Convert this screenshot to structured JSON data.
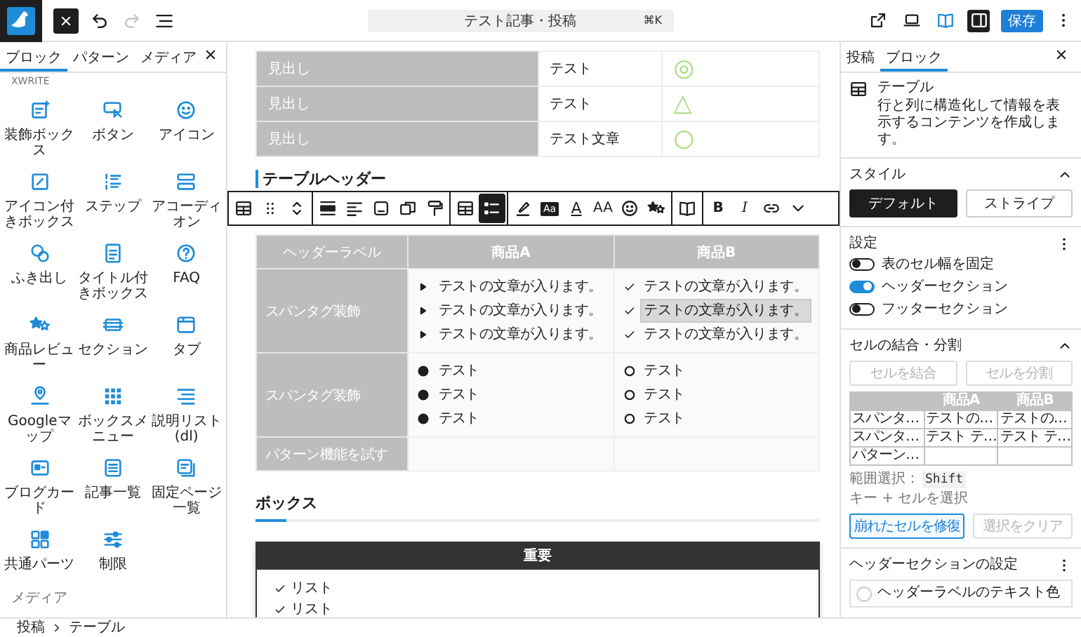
{
  "top_bar": {
    "history": [
      {
        "disabled": false
      },
      {
        "disabled": true
      }
    ],
    "command": {
      "title": "テスト記事・投稿",
      "shortcut": "⌘K"
    },
    "view_buttons": [
      {
        "selected": false
      },
      {
        "selected": false
      },
      {
        "selected": false
      },
      {
        "selected": true
      }
    ],
    "save": "保存"
  },
  "inserter": {
    "tabs": [
      {
        "label": "ブロック",
        "selected": true
      },
      {
        "label": "パターン",
        "selected": false
      },
      {
        "label": "メディア",
        "selected": false
      }
    ],
    "category": "XWRITE",
    "blocks": [
      "装飾ボックス",
      "ボタン",
      "アイコン",
      "アイコン付きボックス",
      "ステップ",
      "アコーディオン",
      "ふき出し",
      "タイトル付きボックス",
      "FAQ",
      "商品レビュー",
      "セクション",
      "タブ",
      "Googleマップ",
      "ボックスメニュー",
      "説明リスト(dl)",
      "ブログカード",
      "記事一覧",
      "固定ページ一覧",
      "共通パーツ",
      "制限"
    ],
    "next_category": "メディア"
  },
  "editor": {
    "top_table": {
      "rows": [
        {
          "header": "見出し",
          "text": "テスト",
          "mark": "◎"
        },
        {
          "header": "見出し",
          "text": "テスト",
          "mark": "△"
        },
        {
          "header": "見出し",
          "text": "テスト文章",
          "mark": "○"
        }
      ]
    },
    "heading": "テーブルヘッダー",
    "toolbar": {
      "groups": [
        {
          "items": [
            {
              "kind": "icon",
              "selected": false
            },
            {
              "kind": "icon",
              "selected": false
            },
            {
              "kind": "icon",
              "selected": false
            }
          ]
        },
        {
          "items": [
            {
              "kind": "icon",
              "selected": false
            },
            {
              "kind": "icon",
              "selected": false
            },
            {
              "kind": "icon",
              "selected": false
            },
            {
              "kind": "icon",
              "selected": false
            },
            {
              "kind": "icon",
              "selected": false
            }
          ]
        },
        {
          "items": [
            {
              "kind": "icon",
              "selected": false
            },
            {
              "kind": "icon",
              "selected": true
            }
          ]
        },
        {
          "items": [
            {
              "kind": "icon",
              "selected": false
            },
            {
              "kind": "badge",
              "label": "Aa",
              "selected": false
            },
            {
              "kind": "underline",
              "label": "A",
              "selected": false
            },
            {
              "kind": "text",
              "label": "AA",
              "selected": false
            },
            {
              "kind": "icon",
              "selected": false
            },
            {
              "kind": "icon",
              "selected": false
            }
          ]
        },
        {
          "items": [
            {
              "kind": "icon",
              "selected": false
            }
          ]
        },
        {
          "items": [
            {
              "kind": "bold",
              "label": "B",
              "selected": false
            },
            {
              "kind": "italic",
              "label": "I",
              "selected": false
            },
            {
              "kind": "icon",
              "selected": false
            },
            {
              "kind": "icon",
              "selected": false
            }
          ]
        }
      ]
    },
    "table": {
      "columns": [
        "ヘッダーラベル",
        "商品A",
        "商品B"
      ],
      "rows": [
        {
          "cells": [
            {
              "kind": "header",
              "text": "スパンタグ装飾"
            },
            {
              "kind": "triangle",
              "items": [
                {
                  "text": "テストの文章が入ります。",
                  "highlighted": false
                },
                {
                  "text": "テストの文章が入ります。",
                  "highlighted": false
                },
                {
                  "text": "テストの文章が入ります。",
                  "highlighted": false
                }
              ]
            },
            {
              "kind": "check",
              "items": [
                {
                  "text": "テストの文章が入ります。",
                  "highlighted": false
                },
                {
                  "text": "テストの文章が入ります。",
                  "highlighted": true
                },
                {
                  "text": "テストの文章が入ります。",
                  "highlighted": false
                }
              ]
            }
          ]
        },
        {
          "cells": [
            {
              "kind": "header",
              "text": "スパンタグ装飾"
            },
            {
              "kind": "dot",
              "items": [
                {
                  "text": "テスト",
                  "highlighted": false
                },
                {
                  "text": "テスト",
                  "highlighted": false
                },
                {
                  "text": "テスト",
                  "highlighted": false
                }
              ]
            },
            {
              "kind": "circle",
              "items": [
                {
                  "text": "テスト",
                  "highlighted": false
                },
                {
                  "text": "テスト",
                  "highlighted": false
                },
                {
                  "text": "テスト",
                  "highlighted": false
                }
              ]
            }
          ]
        },
        {
          "cells": [
            {
              "kind": "header",
              "text": "パターン機能を試す"
            },
            {
              "kind": "empty"
            },
            {
              "kind": "empty"
            }
          ]
        }
      ]
    },
    "box_section": {
      "heading": "ボックス",
      "box": {
        "title": "重要",
        "items": [
          "リスト",
          "リスト"
        ]
      }
    }
  },
  "sidebar": {
    "tabs": [
      {
        "label": "投稿",
        "selected": false
      },
      {
        "label": "ブロック",
        "selected": true
      }
    ],
    "block": {
      "title": "テーブル",
      "description": "行と列に構造化して情報を表示するコンテンツを作成します。"
    },
    "style": {
      "title": "スタイル",
      "options": [
        {
          "label": "デフォルト",
          "selected": true
        },
        {
          "label": "ストライプ",
          "selected": false
        }
      ]
    },
    "settings": {
      "title": "設定",
      "toggles": [
        {
          "label": "表のセル幅を固定",
          "on": false
        },
        {
          "label": "ヘッダーセクション",
          "on": true
        },
        {
          "label": "フッターセクション",
          "on": false
        }
      ]
    },
    "cells": {
      "title": "セルの結合・分割",
      "buttons": [
        {
          "label": "セルを結合",
          "disabled": true
        },
        {
          "label": "セルを分割",
          "disabled": true
        }
      ],
      "preview": {
        "header": [
          "商品A",
          "商品B"
        ],
        "rows": [
          [
            "スパンタ…",
            "テストの…",
            "テストの…"
          ],
          [
            "スパンタ…",
            "テスト テ…",
            "テスト テ…"
          ],
          [
            "パターン…"
          ]
        ]
      },
      "hint": {
        "prefix": "範囲選択：",
        "key": "Shift",
        "suffix": "キー + セルを選択"
      },
      "actions": [
        {
          "label": "崩れたセルを修復",
          "disabled": false
        },
        {
          "label": "選択をクリア",
          "disabled": true
        }
      ]
    },
    "header_settings": {
      "title": "ヘッダーセクションの設定",
      "color_option": "ヘッダーラベルのテキスト色"
    }
  },
  "breadcrumb": [
    "投稿",
    "テーブル"
  ]
}
